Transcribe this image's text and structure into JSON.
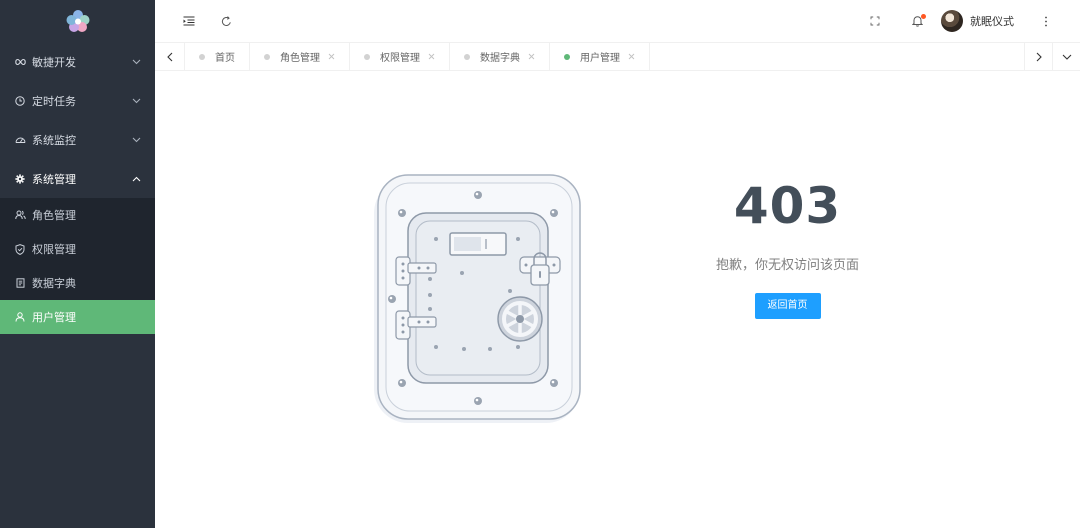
{
  "sidebar": {
    "logo": "pinwheel-logo",
    "groups": [
      {
        "label": "敏捷开发",
        "icon": "infinity-icon"
      },
      {
        "label": "定时任务",
        "icon": "clock-icon"
      },
      {
        "label": "系统监控",
        "icon": "dashboard-icon"
      },
      {
        "label": "系统管理",
        "icon": "gear-icon",
        "open": true
      }
    ],
    "subitems": [
      {
        "label": "角色管理",
        "icon": "users-icon"
      },
      {
        "label": "权限管理",
        "icon": "shield-icon"
      },
      {
        "label": "数据字典",
        "icon": "document-icon"
      },
      {
        "label": "用户管理",
        "icon": "user-icon",
        "active": true
      }
    ]
  },
  "header": {
    "user_name": "就眠仪式"
  },
  "tabs": [
    {
      "label": "首页",
      "closable": false
    },
    {
      "label": "角色管理",
      "closable": true
    },
    {
      "label": "权限管理",
      "closable": true
    },
    {
      "label": "数据字典",
      "closable": true
    },
    {
      "label": "用户管理",
      "closable": true,
      "active": true
    }
  ],
  "error": {
    "code": "403",
    "message": "抱歉，你无权访问该页面",
    "button_label": "返回首页"
  },
  "colors": {
    "sidebar_bg": "#2b323d",
    "active_green": "#5fb878",
    "button_blue": "#1e9fff",
    "notification_red": "#ff5722"
  }
}
